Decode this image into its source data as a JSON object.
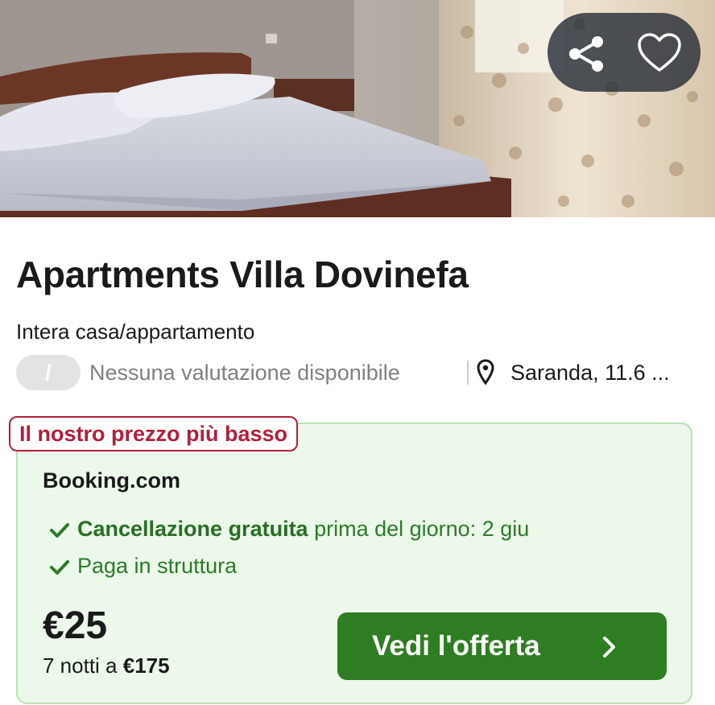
{
  "listing": {
    "title": "Apartments Villa Dovinefa",
    "type": "Intera casa/appartamento",
    "rating_value": "/",
    "rating_text": "Nessuna valutazione disponibile",
    "location": "Saranda, 11.6 ..."
  },
  "offer": {
    "badge": "Il nostro prezzo più basso",
    "provider": "Booking.com",
    "perk_1_strong": "Cancellazione gratuita",
    "perk_1_rest": "prima del giorno: 2 giu",
    "perk_2": "Paga in struttura",
    "price": "€25",
    "nights_prefix": "7 notti a",
    "nights_total": "€175",
    "cta_label": "Vedi l'offerta"
  },
  "icons": {
    "share": "share-icon",
    "favorite": "heart-icon",
    "location": "location-pin-icon",
    "check": "check-icon",
    "chevron": "chevron-right-icon"
  },
  "colors": {
    "offer_bg": "#ebf8ea",
    "offer_border": "#b7e3b4",
    "badge": "#b0203c",
    "perk_green": "#2f7a2a",
    "cta_green": "#2f7d23"
  }
}
